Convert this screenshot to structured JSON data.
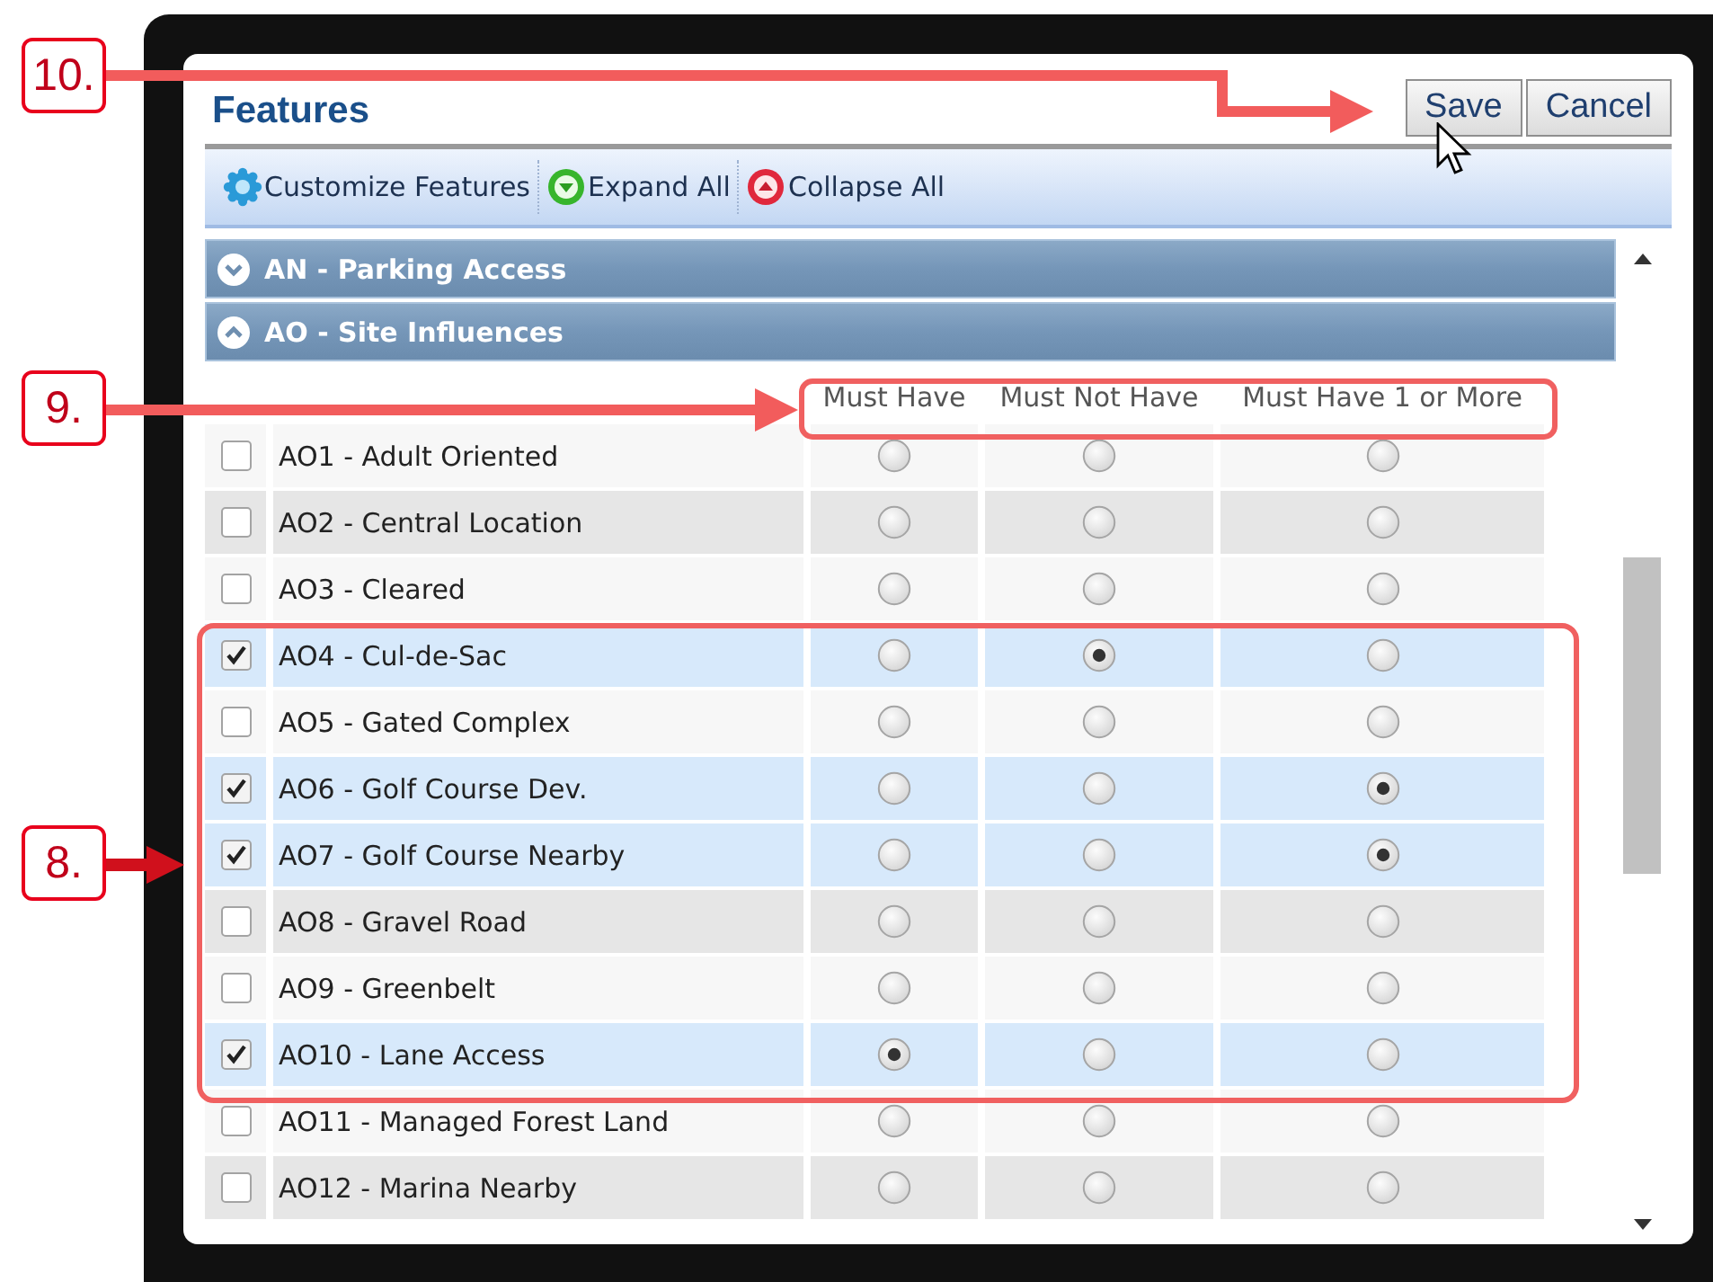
{
  "dialog": {
    "title": "Features",
    "buttons": [
      {
        "label": "Save"
      },
      {
        "label": "Cancel"
      }
    ]
  },
  "toolbar": [
    {
      "label": "Customize Features",
      "kind": "customize"
    },
    {
      "label": "Expand All",
      "kind": "expand"
    },
    {
      "label": "Collapse All",
      "kind": "collapse"
    }
  ],
  "sections": [
    {
      "title": "AN - Parking Access",
      "expanded": false
    },
    {
      "title": "AO - Site Influences",
      "expanded": true,
      "columns": [
        "Must Have",
        "Must Not Have",
        "Must Have 1 or More"
      ],
      "rows": [
        {
          "label": "AO1 - Adult Oriented",
          "checked": false,
          "options": [
            {
              "selected": false
            },
            {
              "selected": false
            },
            {
              "selected": false
            }
          ]
        },
        {
          "label": "AO2 - Central Location",
          "checked": false,
          "options": [
            {
              "selected": false
            },
            {
              "selected": false
            },
            {
              "selected": false
            }
          ]
        },
        {
          "label": "AO3 - Cleared",
          "checked": false,
          "options": [
            {
              "selected": false
            },
            {
              "selected": false
            },
            {
              "selected": false
            }
          ]
        },
        {
          "label": "AO4 - Cul-de-Sac",
          "checked": true,
          "options": [
            {
              "selected": false
            },
            {
              "selected": true
            },
            {
              "selected": false
            }
          ]
        },
        {
          "label": "AO5 - Gated Complex",
          "checked": false,
          "options": [
            {
              "selected": false
            },
            {
              "selected": false
            },
            {
              "selected": false
            }
          ]
        },
        {
          "label": "AO6 - Golf Course Dev.",
          "checked": true,
          "options": [
            {
              "selected": false
            },
            {
              "selected": false
            },
            {
              "selected": true
            }
          ]
        },
        {
          "label": "AO7 - Golf Course Nearby",
          "checked": true,
          "options": [
            {
              "selected": false
            },
            {
              "selected": false
            },
            {
              "selected": true
            }
          ]
        },
        {
          "label": "AO8 - Gravel Road",
          "checked": false,
          "options": [
            {
              "selected": false
            },
            {
              "selected": false
            },
            {
              "selected": false
            }
          ]
        },
        {
          "label": "AO9 - Greenbelt",
          "checked": false,
          "options": [
            {
              "selected": false
            },
            {
              "selected": false
            },
            {
              "selected": false
            }
          ]
        },
        {
          "label": "AO10 - Lane Access",
          "checked": true,
          "options": [
            {
              "selected": true
            },
            {
              "selected": false
            },
            {
              "selected": false
            }
          ]
        },
        {
          "label": "AO11 - Managed Forest Land",
          "checked": false,
          "options": [
            {
              "selected": false
            },
            {
              "selected": false
            },
            {
              "selected": false
            }
          ]
        },
        {
          "label": "AO12 - Marina Nearby",
          "checked": false,
          "options": [
            {
              "selected": false
            },
            {
              "selected": false
            },
            {
              "selected": false
            }
          ]
        }
      ]
    }
  ],
  "callouts": [
    {
      "label": "10."
    },
    {
      "label": "9."
    },
    {
      "label": "8."
    }
  ]
}
